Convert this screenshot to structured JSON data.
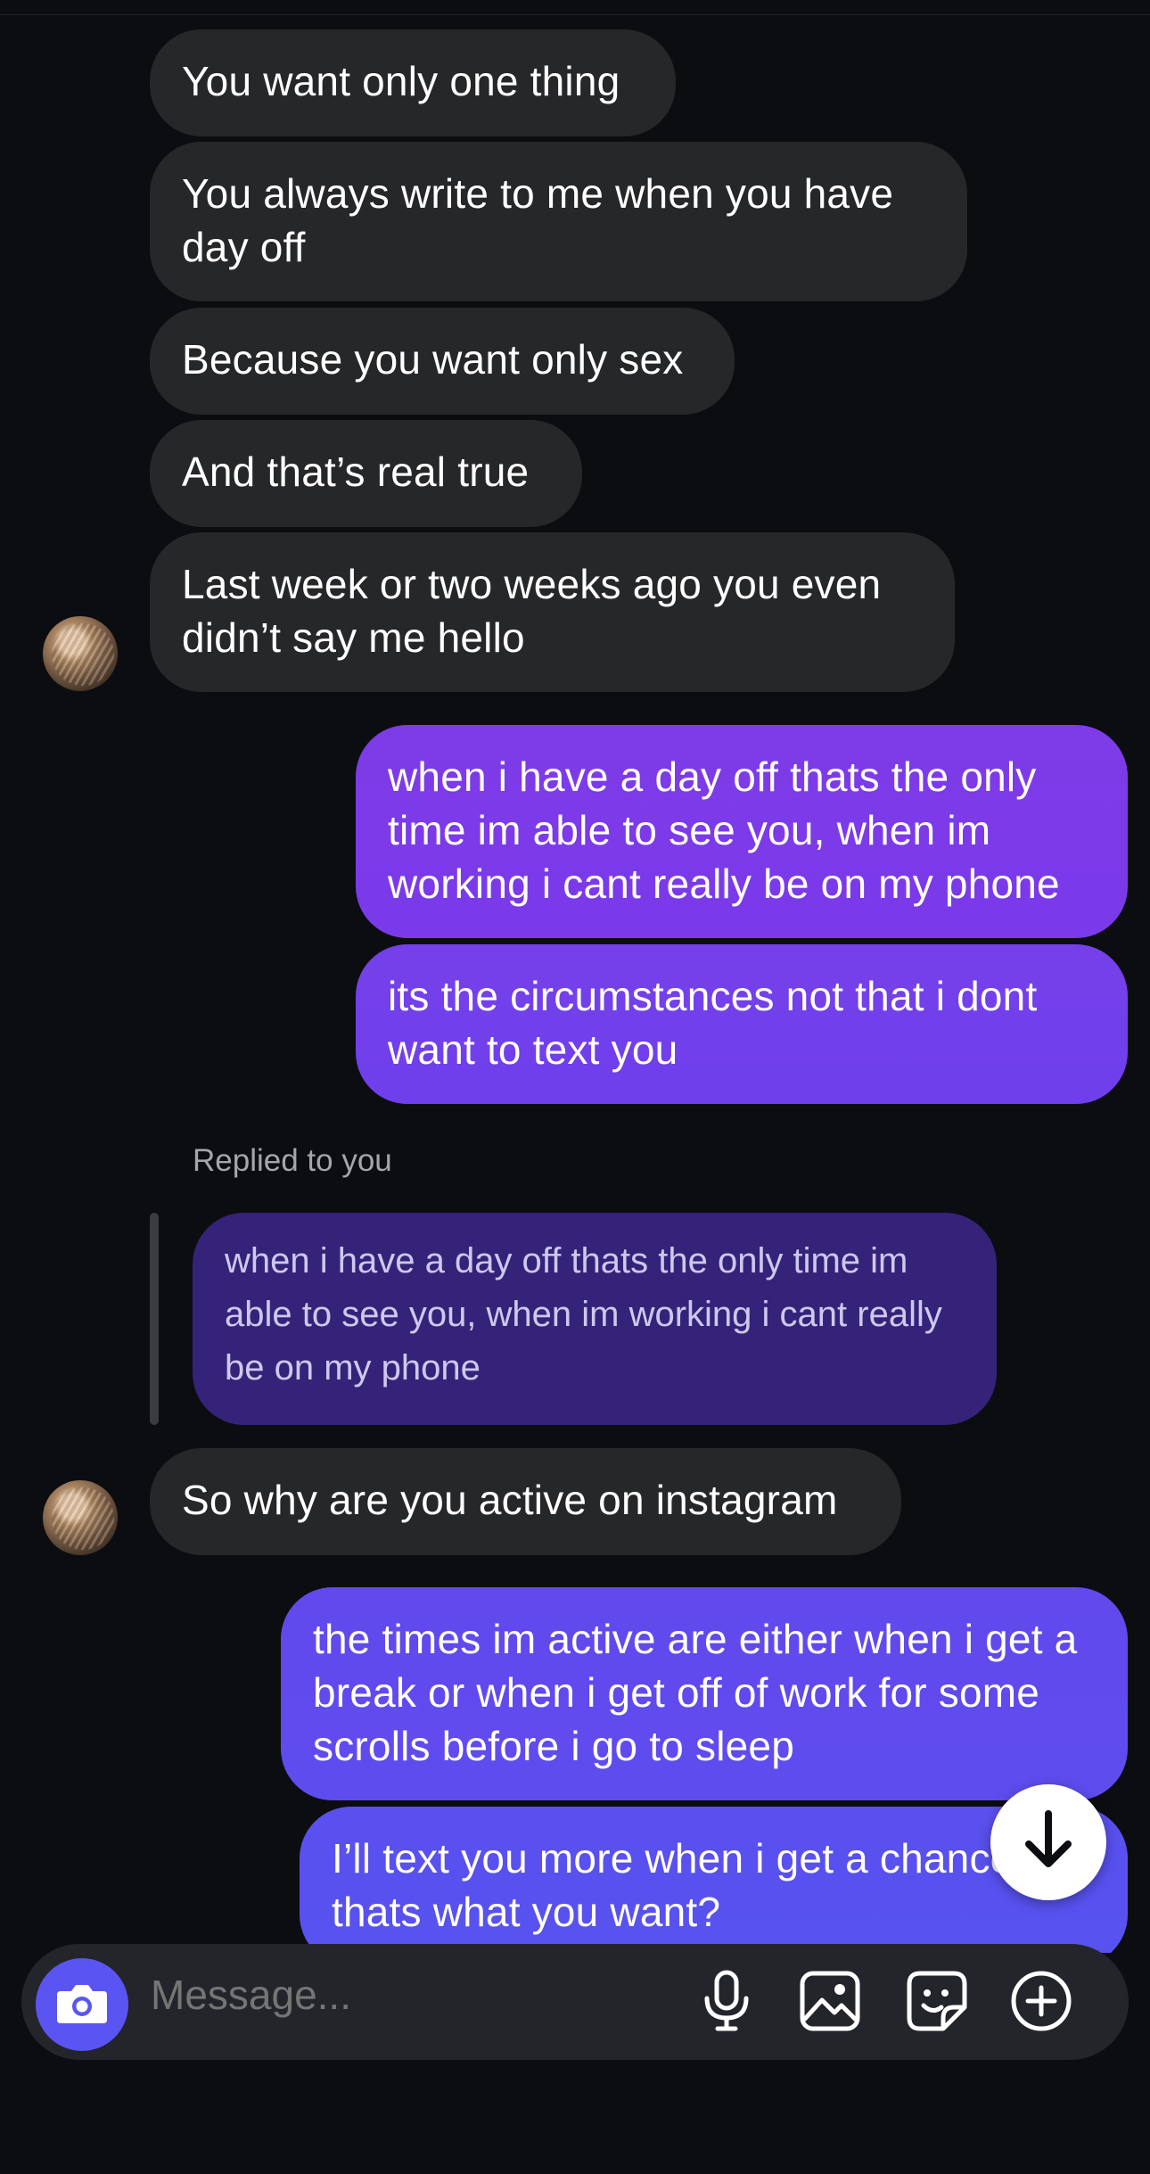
{
  "messages": {
    "m1": "You want only one thing",
    "m2": "You always write to me when you have day off",
    "m3": "Because you want only sex",
    "m4": "And that’s real true",
    "m5": "Last week or two weeks ago you even didn’t say me hello",
    "m6": "when i have a day off thats the only time im able to see you, when im working i cant really be on my phone",
    "m7": "its the circumstances not that i dont want to text you",
    "reply_label": "Replied to you",
    "reply_quote": "when i have a day off thats the only time im able to see you, when im working i cant really be on my phone",
    "m8": "So why are you active on instagram",
    "m9": "the times im active are either when i get a break or when i get off of work for some scrolls before i go to sleep",
    "m10": "I’ll text you more when i get a chance thats what you want?"
  },
  "composer": {
    "placeholder": "Message..."
  },
  "colors": {
    "background": "#0c0d11",
    "incoming_bubble": "#262729",
    "outgoing_gradient_top": "#7b3ae9",
    "outgoing_gradient_bottom": "#5a52ee",
    "reply_bubble": "#35237a",
    "camera_button": "#5a55f2"
  },
  "icons": [
    "camera-icon",
    "microphone-icon",
    "image-icon",
    "sticker-icon",
    "plus-circle-icon",
    "arrow-down-icon"
  ]
}
